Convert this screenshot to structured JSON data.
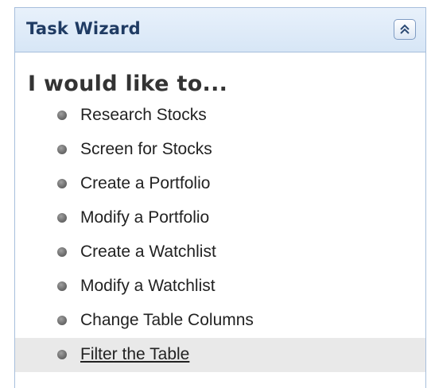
{
  "panel": {
    "title": "Task Wizard",
    "collapse_icon": "double-chevron-up-icon"
  },
  "intro": "I would like to...",
  "tasks": [
    {
      "label": "Research Stocks"
    },
    {
      "label": "Screen for Stocks"
    },
    {
      "label": "Create a Portfolio"
    },
    {
      "label": "Modify a Portfolio"
    },
    {
      "label": "Create a Watchlist"
    },
    {
      "label": "Modify a Watchlist"
    },
    {
      "label": "Change Table Columns"
    },
    {
      "label": "Filter the Table"
    }
  ],
  "hovered_task": "Filter the Table",
  "colors": {
    "header_bg": "#d7e6f6",
    "border": "#a7bfdc",
    "title": "#1f3b63",
    "highlight_bg": "#e9e9e9"
  }
}
